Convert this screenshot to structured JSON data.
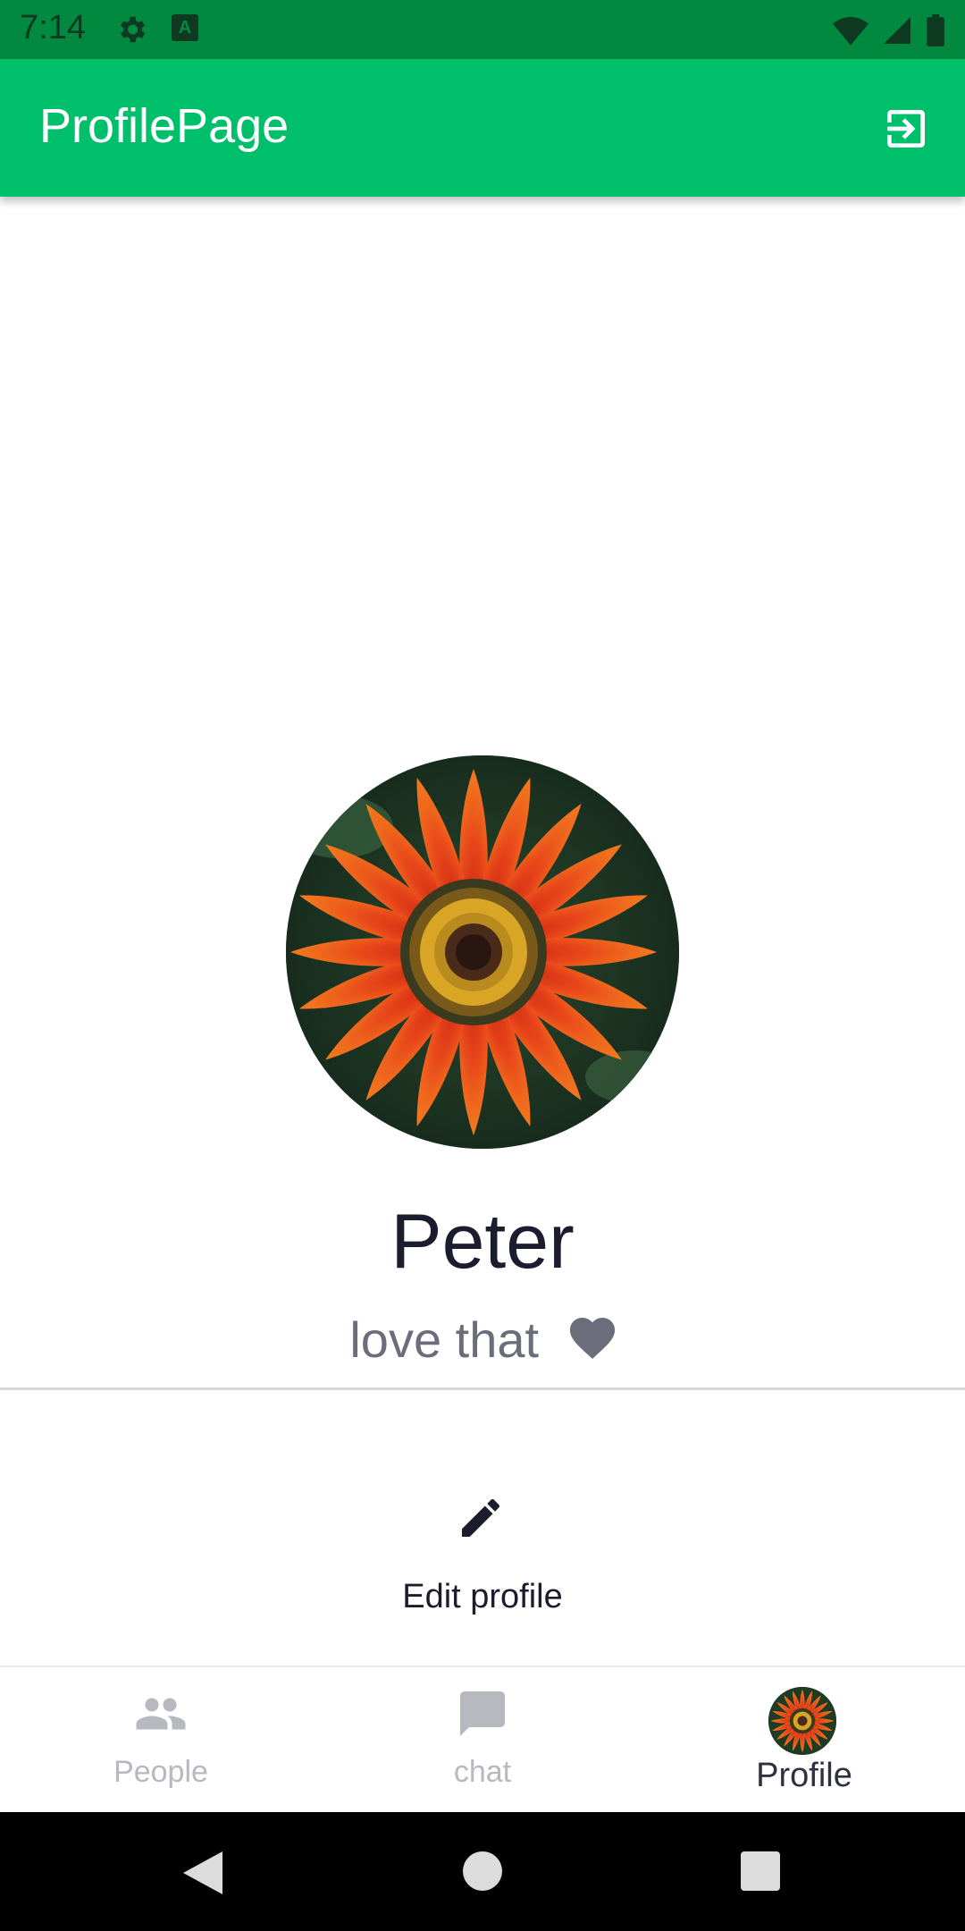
{
  "status_bar": {
    "time": "7:14",
    "icons": [
      "gear-icon",
      "a-icon",
      "wifi-icon",
      "signal-icon",
      "battery-icon"
    ]
  },
  "app_bar": {
    "title": "ProfilePage",
    "action_icon": "logout-icon"
  },
  "profile": {
    "name": "Peter",
    "status": "love that",
    "status_icon": "heart-icon"
  },
  "actions": {
    "edit_label": "Edit profile",
    "edit_icon": "pencil-icon"
  },
  "bottom_nav": {
    "items": [
      {
        "label": "People",
        "icon": "people-icon",
        "active": false
      },
      {
        "label": "chat",
        "icon": "chat-icon",
        "active": false
      },
      {
        "label": "Profile",
        "icon": "avatar",
        "active": true
      }
    ]
  },
  "system_nav": [
    "back-icon",
    "home-icon",
    "recents-icon"
  ],
  "colors": {
    "app_bar": "#00bf6a",
    "status_bar": "#00893f",
    "text_primary": "#1b1d2e",
    "text_secondary": "#6b6d7a",
    "nav_inactive": "#b8b9c0"
  }
}
